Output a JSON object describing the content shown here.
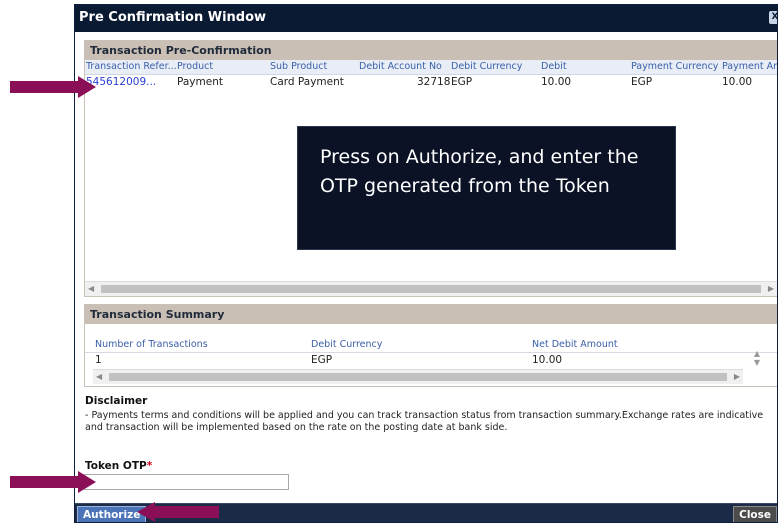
{
  "window": {
    "title": "Pre Confirmation Window",
    "close_glyph": "X"
  },
  "preconfirm": {
    "title": "Transaction Pre-Confirmation",
    "headers": [
      "Transaction Refer...",
      "Product",
      "Sub Product",
      "Debit Account No",
      "Debit Currency",
      "Debit",
      "Payment Currency",
      "Payment Amo"
    ],
    "row": [
      "545612009...",
      "Payment",
      "Card Payment",
      "32718",
      "EGP",
      "10.00",
      "EGP",
      "10.00"
    ]
  },
  "callout": {
    "text": "Press on Authorize, and enter the OTP generated from the Token"
  },
  "summary": {
    "title": "Transaction Summary",
    "headers": [
      "Number of Transactions",
      "Debit Currency",
      "Net Debit Amount"
    ],
    "row": [
      "1",
      "EGP",
      "10.00"
    ]
  },
  "disclaimer": {
    "title": "Disclaimer",
    "text": "- Payments terms and conditions will be applied and you can track transaction status from transaction summary.Exchange rates are indicative and transaction will be implemented based on the rate on the posting date at bank side."
  },
  "otp": {
    "label": "Token OTP",
    "required_mark": "*",
    "value": ""
  },
  "footer": {
    "authorize_label": "Authorize",
    "close_label": "Close"
  },
  "colors": {
    "titlebar": "#0b1a33",
    "panel_header": "#c9bfb4",
    "callout": "#0b1226",
    "arrow": "#8b0f57",
    "authorize_button": "#4a73b8"
  },
  "icons": [
    "close-icon",
    "arrow-left-icon",
    "arrow-right-icon",
    "arrow-up-icon",
    "arrow-down-icon",
    "annotation-arrow-icon"
  ]
}
